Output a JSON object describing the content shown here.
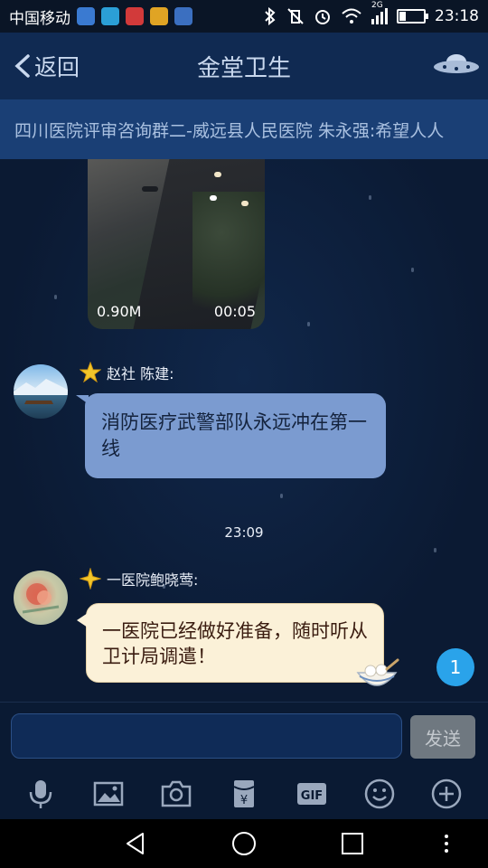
{
  "status_bar": {
    "carrier": "中国移动",
    "network_label": "2G",
    "time": "23:18",
    "battery_level": 0.25
  },
  "nav": {
    "back_label": "返回",
    "title": "金堂卫生"
  },
  "announcement": {
    "text": "四川医院评审咨询群二-威远县人民医院  朱永强:希望人人"
  },
  "messages": {
    "video": {
      "size": "0.90M",
      "duration": "00:05"
    },
    "msg1": {
      "sender": "赵社   陈建:",
      "text": "消防医疗武警部队永远冲在第一线"
    },
    "timestamp": "23:09",
    "msg2": {
      "sender": "一医院鲍晓莺:",
      "text": "一医院已经做好准备，随时听从卫计局调遣！"
    },
    "unread_count": "1"
  },
  "input": {
    "value": "",
    "send_label": "发送"
  },
  "toolbar": {
    "gif_label": "GIF"
  },
  "colors": {
    "nav_bg": "#102a52",
    "announce_bg": "#1a3f75",
    "bubble_blue": "#7b9bd0",
    "bubble_cream": "#fbf1d8",
    "badge": "#2aa3ea"
  }
}
